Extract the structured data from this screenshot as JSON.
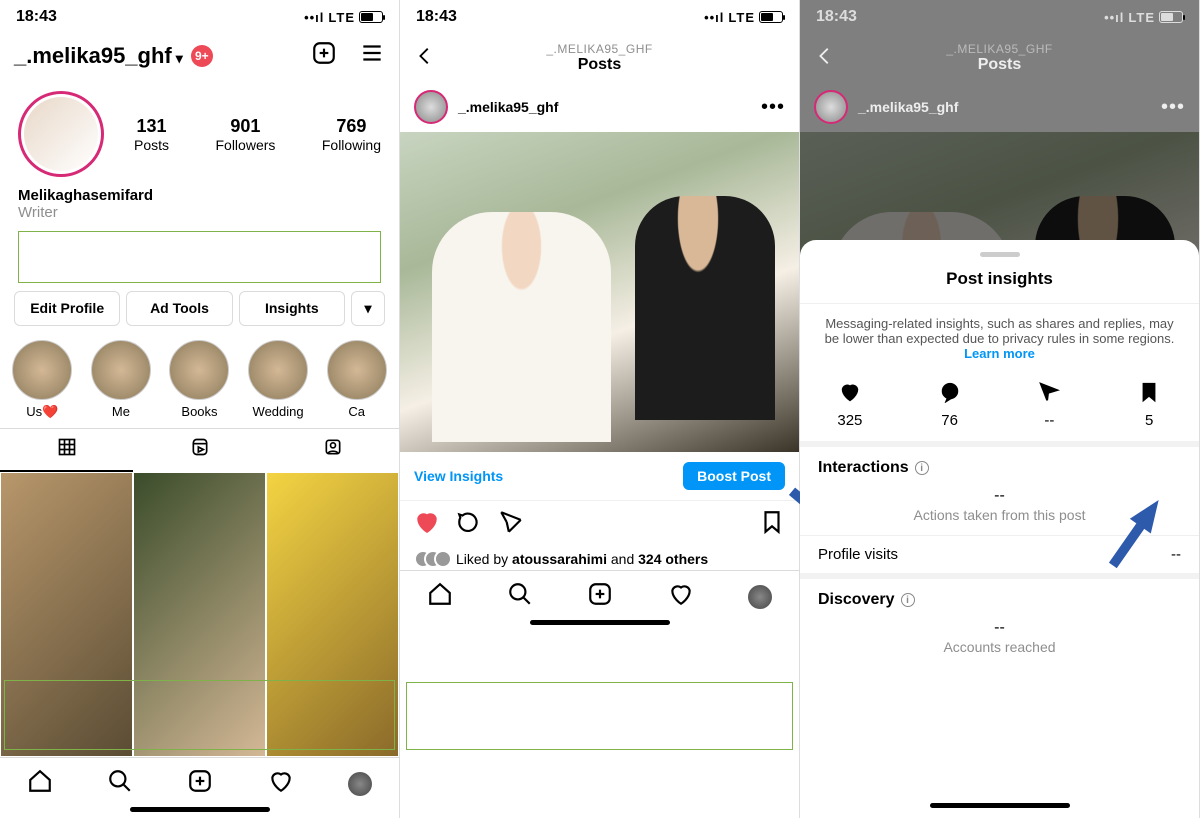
{
  "status": {
    "time": "18:43",
    "network": "LTE"
  },
  "phone1": {
    "username": "_.melika95_ghf",
    "badge": "9+",
    "stats": {
      "posts": "131",
      "followers": "901",
      "following": "769",
      "posts_label": "Posts",
      "followers_label": "Followers",
      "following_label": "Following"
    },
    "name": "Melikaghasemifard",
    "subtitle": "Writer",
    "buttons": {
      "edit": "Edit Profile",
      "ads": "Ad Tools",
      "insights": "Insights"
    },
    "highlights": [
      {
        "label": "Us❤️"
      },
      {
        "label": "Me"
      },
      {
        "label": "Books"
      },
      {
        "label": "Wedding"
      },
      {
        "label": "Ca"
      }
    ]
  },
  "phone2": {
    "header_small": "_.MELIKA95_GHF",
    "header_big": "Posts",
    "poster": "_.melika95_ghf",
    "view_insights": "View Insights",
    "boost": "Boost Post",
    "liked_prefix": "Liked by ",
    "liked_user": "atoussarahimi",
    "liked_suffix": " and ",
    "liked_count": "324 others"
  },
  "phone3": {
    "header_small": "_.MELIKA95_GHF",
    "header_big": "Posts",
    "poster": "_.melika95_ghf",
    "title": "Post insights",
    "notice": "Messaging-related insights, such as shares and replies, may be lower than expected due to privacy rules in some regions. ",
    "learn_more": "Learn more",
    "metrics": {
      "likes": "325",
      "comments": "76",
      "shares": "--",
      "saves": "5"
    },
    "interactions": "Interactions",
    "actions_dash": "--",
    "actions_sub": "Actions taken from this post",
    "profile_visits": "Profile visits",
    "profile_visits_val": "--",
    "discovery": "Discovery",
    "reach_dash": "--",
    "reach_sub": "Accounts reached"
  }
}
